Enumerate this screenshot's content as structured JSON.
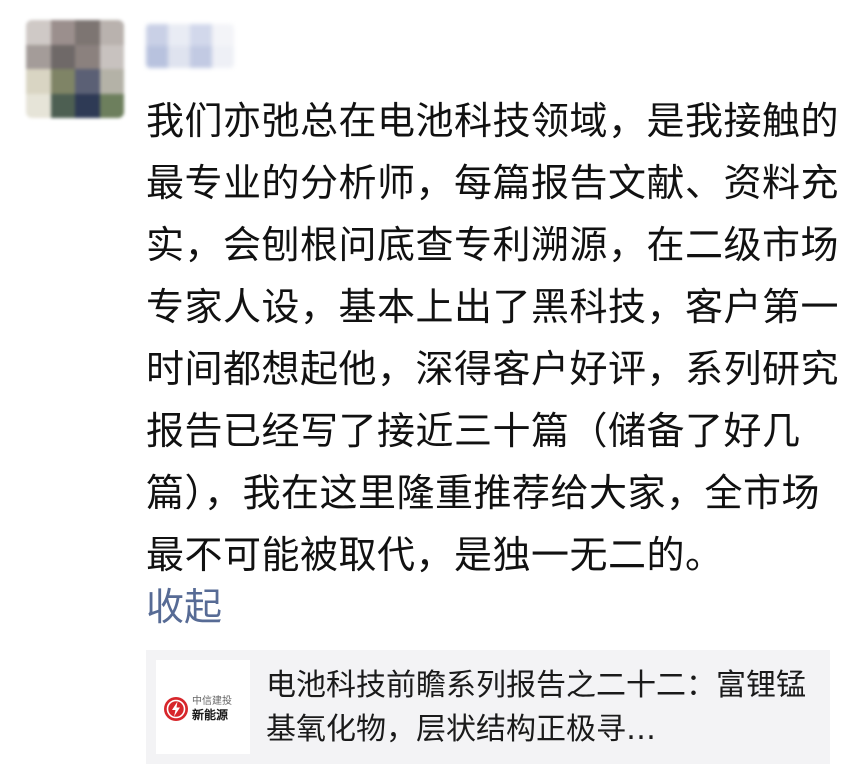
{
  "post": {
    "text": "我们亦弛总在电池科技领域，是我接触的最专业的分析师，每篇报告文献、资料充实，会刨根问底查专利溯源，在二级市场专家人设，基本上出了黑科技，客户第一时间都想起他，深得客户好评，系列研究报告已经写了接近三十篇（储备了好几篇），我在这里隆重推荐给大家，全市场最不可能被取代，是独一无二的。",
    "collapse_label": "收起"
  },
  "share_card": {
    "logo_icon": "lightning-bolt-icon",
    "logo_text_top": "中信建投",
    "logo_text_bottom": "新能源",
    "title": "电池科技前瞻系列报告之二十二：富锂锰基氧化物，层状结构正极寻…"
  },
  "colors": {
    "link": "#576b95",
    "card_background": "#f3f3f5",
    "logo_red": "#d7262b",
    "text": "#111111"
  }
}
